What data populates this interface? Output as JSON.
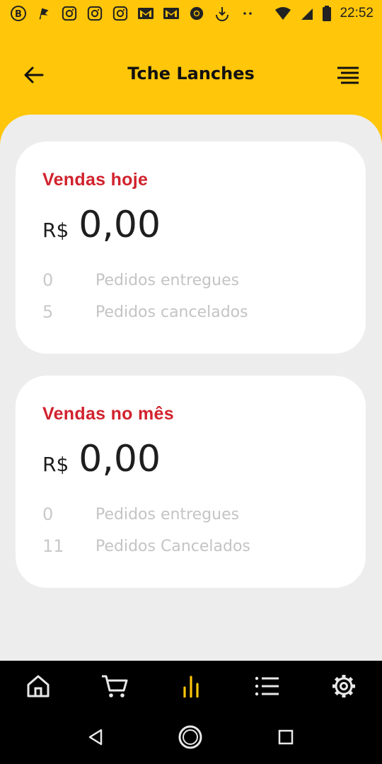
{
  "status_bar": {
    "time": "22:52",
    "notification_icons": [
      "bitcoin-icon",
      "flag-icon",
      "instagram-icon",
      "instagram-icon",
      "instagram-icon",
      "gmail-icon",
      "gmail-icon",
      "chrome-icon",
      "download-icon",
      "dots-icon"
    ],
    "system_icons": [
      "wifi-icon",
      "signal-icon",
      "battery-icon"
    ]
  },
  "header": {
    "title": "Tche Lanches",
    "back_icon": "arrow-left-icon",
    "menu_icon": "menu-icon"
  },
  "cards": [
    {
      "title": "Vendas hoje",
      "currency": "R$",
      "amount": "0,00",
      "stats": [
        {
          "count": "0",
          "label": "Pedidos entregues"
        },
        {
          "count": "5",
          "label": "Pedidos cancelados"
        }
      ]
    },
    {
      "title": "Vendas no mês",
      "currency": "R$",
      "amount": "0,00",
      "stats": [
        {
          "count": "0",
          "label": "Pedidos entregues"
        },
        {
          "count": "11",
          "label": "Pedidos Cancelados"
        }
      ]
    }
  ],
  "bottom_nav": {
    "items": [
      "home-icon",
      "cart-icon",
      "bar-chart-icon",
      "list-icon",
      "settings-icon"
    ],
    "active": "bar-chart-icon",
    "active_color": "#FFC60A"
  },
  "colors": {
    "accent": "#FFC60A",
    "title_red": "#D1222D",
    "background": "#EDEDED"
  }
}
